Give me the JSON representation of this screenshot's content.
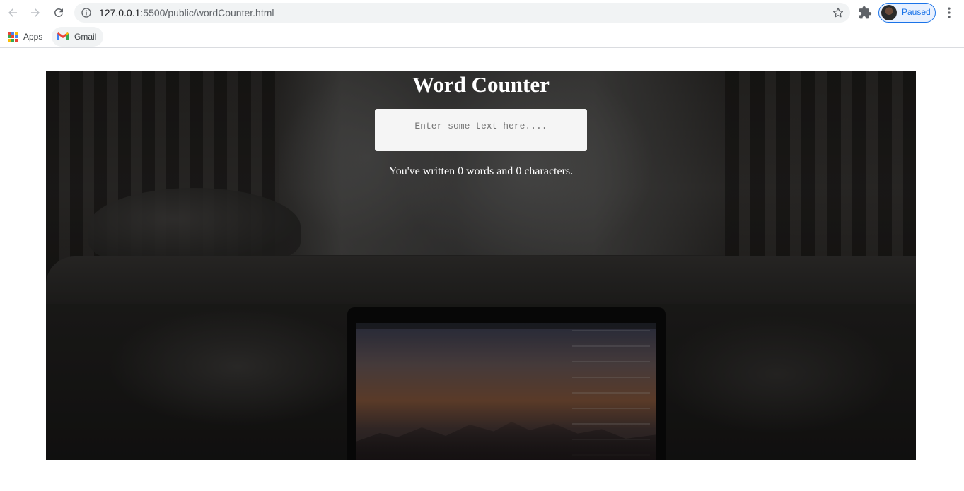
{
  "browser": {
    "url_host": "127.0.0.1",
    "url_path": ":5500/public/wordCounter.html",
    "profile_label": "Paused",
    "bookmarks": [
      {
        "label": "Apps",
        "icon": "apps-grid-icon"
      },
      {
        "label": "Gmail",
        "icon": "gmail-icon"
      }
    ]
  },
  "page": {
    "title": "Word Counter",
    "input_placeholder": "Enter some text here....",
    "input_value": "",
    "result_prefix": "You've written ",
    "words": "0",
    "result_middle": " words and ",
    "characters": "0",
    "result_suffix": " characters."
  },
  "colors": {
    "accent": "#1a73e8",
    "title_text": "#ffffff",
    "input_bg": "#f5f5f5"
  }
}
